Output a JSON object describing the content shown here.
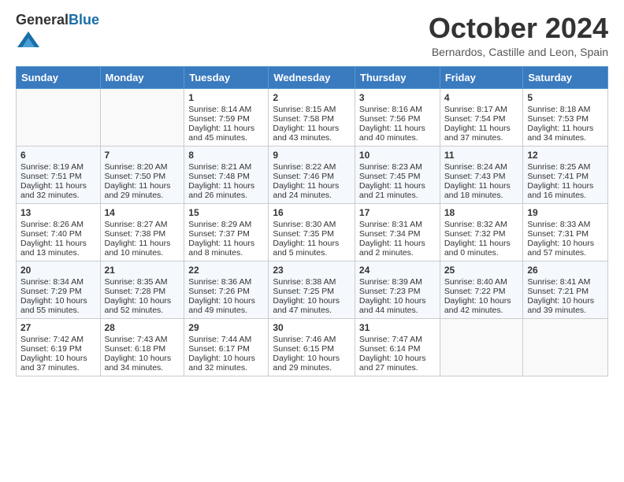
{
  "header": {
    "logo_general": "General",
    "logo_blue": "Blue",
    "month_title": "October 2024",
    "location": "Bernardos, Castille and Leon, Spain"
  },
  "days_of_week": [
    "Sunday",
    "Monday",
    "Tuesday",
    "Wednesday",
    "Thursday",
    "Friday",
    "Saturday"
  ],
  "weeks": [
    [
      {
        "day": "",
        "sunrise": "",
        "sunset": "",
        "daylight": ""
      },
      {
        "day": "",
        "sunrise": "",
        "sunset": "",
        "daylight": ""
      },
      {
        "day": "1",
        "sunrise": "Sunrise: 8:14 AM",
        "sunset": "Sunset: 7:59 PM",
        "daylight": "Daylight: 11 hours and 45 minutes."
      },
      {
        "day": "2",
        "sunrise": "Sunrise: 8:15 AM",
        "sunset": "Sunset: 7:58 PM",
        "daylight": "Daylight: 11 hours and 43 minutes."
      },
      {
        "day": "3",
        "sunrise": "Sunrise: 8:16 AM",
        "sunset": "Sunset: 7:56 PM",
        "daylight": "Daylight: 11 hours and 40 minutes."
      },
      {
        "day": "4",
        "sunrise": "Sunrise: 8:17 AM",
        "sunset": "Sunset: 7:54 PM",
        "daylight": "Daylight: 11 hours and 37 minutes."
      },
      {
        "day": "5",
        "sunrise": "Sunrise: 8:18 AM",
        "sunset": "Sunset: 7:53 PM",
        "daylight": "Daylight: 11 hours and 34 minutes."
      }
    ],
    [
      {
        "day": "6",
        "sunrise": "Sunrise: 8:19 AM",
        "sunset": "Sunset: 7:51 PM",
        "daylight": "Daylight: 11 hours and 32 minutes."
      },
      {
        "day": "7",
        "sunrise": "Sunrise: 8:20 AM",
        "sunset": "Sunset: 7:50 PM",
        "daylight": "Daylight: 11 hours and 29 minutes."
      },
      {
        "day": "8",
        "sunrise": "Sunrise: 8:21 AM",
        "sunset": "Sunset: 7:48 PM",
        "daylight": "Daylight: 11 hours and 26 minutes."
      },
      {
        "day": "9",
        "sunrise": "Sunrise: 8:22 AM",
        "sunset": "Sunset: 7:46 PM",
        "daylight": "Daylight: 11 hours and 24 minutes."
      },
      {
        "day": "10",
        "sunrise": "Sunrise: 8:23 AM",
        "sunset": "Sunset: 7:45 PM",
        "daylight": "Daylight: 11 hours and 21 minutes."
      },
      {
        "day": "11",
        "sunrise": "Sunrise: 8:24 AM",
        "sunset": "Sunset: 7:43 PM",
        "daylight": "Daylight: 11 hours and 18 minutes."
      },
      {
        "day": "12",
        "sunrise": "Sunrise: 8:25 AM",
        "sunset": "Sunset: 7:41 PM",
        "daylight": "Daylight: 11 hours and 16 minutes."
      }
    ],
    [
      {
        "day": "13",
        "sunrise": "Sunrise: 8:26 AM",
        "sunset": "Sunset: 7:40 PM",
        "daylight": "Daylight: 11 hours and 13 minutes."
      },
      {
        "day": "14",
        "sunrise": "Sunrise: 8:27 AM",
        "sunset": "Sunset: 7:38 PM",
        "daylight": "Daylight: 11 hours and 10 minutes."
      },
      {
        "day": "15",
        "sunrise": "Sunrise: 8:29 AM",
        "sunset": "Sunset: 7:37 PM",
        "daylight": "Daylight: 11 hours and 8 minutes."
      },
      {
        "day": "16",
        "sunrise": "Sunrise: 8:30 AM",
        "sunset": "Sunset: 7:35 PM",
        "daylight": "Daylight: 11 hours and 5 minutes."
      },
      {
        "day": "17",
        "sunrise": "Sunrise: 8:31 AM",
        "sunset": "Sunset: 7:34 PM",
        "daylight": "Daylight: 11 hours and 2 minutes."
      },
      {
        "day": "18",
        "sunrise": "Sunrise: 8:32 AM",
        "sunset": "Sunset: 7:32 PM",
        "daylight": "Daylight: 11 hours and 0 minutes."
      },
      {
        "day": "19",
        "sunrise": "Sunrise: 8:33 AM",
        "sunset": "Sunset: 7:31 PM",
        "daylight": "Daylight: 10 hours and 57 minutes."
      }
    ],
    [
      {
        "day": "20",
        "sunrise": "Sunrise: 8:34 AM",
        "sunset": "Sunset: 7:29 PM",
        "daylight": "Daylight: 10 hours and 55 minutes."
      },
      {
        "day": "21",
        "sunrise": "Sunrise: 8:35 AM",
        "sunset": "Sunset: 7:28 PM",
        "daylight": "Daylight: 10 hours and 52 minutes."
      },
      {
        "day": "22",
        "sunrise": "Sunrise: 8:36 AM",
        "sunset": "Sunset: 7:26 PM",
        "daylight": "Daylight: 10 hours and 49 minutes."
      },
      {
        "day": "23",
        "sunrise": "Sunrise: 8:38 AM",
        "sunset": "Sunset: 7:25 PM",
        "daylight": "Daylight: 10 hours and 47 minutes."
      },
      {
        "day": "24",
        "sunrise": "Sunrise: 8:39 AM",
        "sunset": "Sunset: 7:23 PM",
        "daylight": "Daylight: 10 hours and 44 minutes."
      },
      {
        "day": "25",
        "sunrise": "Sunrise: 8:40 AM",
        "sunset": "Sunset: 7:22 PM",
        "daylight": "Daylight: 10 hours and 42 minutes."
      },
      {
        "day": "26",
        "sunrise": "Sunrise: 8:41 AM",
        "sunset": "Sunset: 7:21 PM",
        "daylight": "Daylight: 10 hours and 39 minutes."
      }
    ],
    [
      {
        "day": "27",
        "sunrise": "Sunrise: 7:42 AM",
        "sunset": "Sunset: 6:19 PM",
        "daylight": "Daylight: 10 hours and 37 minutes."
      },
      {
        "day": "28",
        "sunrise": "Sunrise: 7:43 AM",
        "sunset": "Sunset: 6:18 PM",
        "daylight": "Daylight: 10 hours and 34 minutes."
      },
      {
        "day": "29",
        "sunrise": "Sunrise: 7:44 AM",
        "sunset": "Sunset: 6:17 PM",
        "daylight": "Daylight: 10 hours and 32 minutes."
      },
      {
        "day": "30",
        "sunrise": "Sunrise: 7:46 AM",
        "sunset": "Sunset: 6:15 PM",
        "daylight": "Daylight: 10 hours and 29 minutes."
      },
      {
        "day": "31",
        "sunrise": "Sunrise: 7:47 AM",
        "sunset": "Sunset: 6:14 PM",
        "daylight": "Daylight: 10 hours and 27 minutes."
      },
      {
        "day": "",
        "sunrise": "",
        "sunset": "",
        "daylight": ""
      },
      {
        "day": "",
        "sunrise": "",
        "sunset": "",
        "daylight": ""
      }
    ]
  ]
}
